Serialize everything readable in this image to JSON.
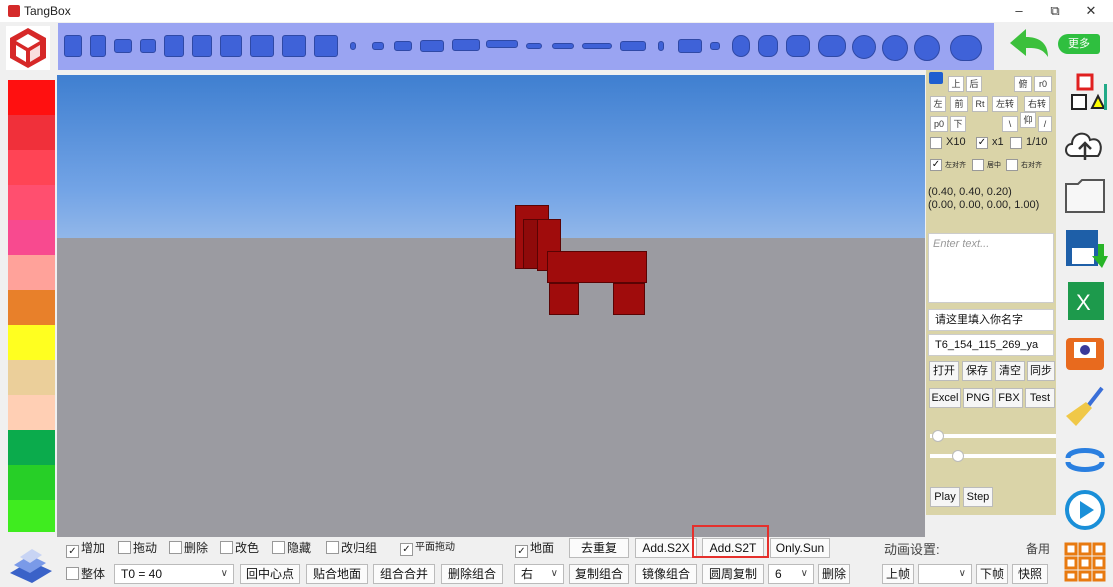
{
  "window": {
    "title": "TangBox",
    "min": "–",
    "restore": "⧉",
    "close": "✕"
  },
  "toolbar": {
    "more_label": "更多"
  },
  "palette": {
    "colors": [
      "#ff1010",
      "#f0303a",
      "#ff4455",
      "#ff4f6f",
      "#f84a8f",
      "#ffa29a",
      "#e8802a",
      "#ffff20",
      "#ebcf9a",
      "#ffcfb4",
      "#0bab4c",
      "#27cf27",
      "#3fec1f"
    ]
  },
  "panel": {
    "row1": [
      "上",
      "后",
      "俯",
      "r0"
    ],
    "row2": [
      "左",
      "前",
      "Rt",
      "左转",
      "右转"
    ],
    "row3": [
      "p0",
      "下",
      "\\",
      "仰",
      "/"
    ],
    "scale": [
      "X10",
      "x1",
      "1/10"
    ],
    "align": [
      "左对齐",
      "居中",
      "右对齐"
    ],
    "coords_line1": "(0.40, 0.40, 0.20)",
    "coords_line2": "(0.00, 0.00, 0.00, 1.00)",
    "notes_placeholder": "Enter text...",
    "name_field": "请这里填入你名字",
    "file_field": "T6_154_115_269_ya",
    "file_buttons": [
      "打开",
      "保存",
      "清空",
      "同步"
    ],
    "export_buttons": [
      "Excel",
      "PNG",
      "FBX",
      "Test"
    ],
    "play": "Play",
    "step": "Step"
  },
  "bottom": {
    "row1_checks": [
      "增加",
      "拖动",
      "删除",
      "改色",
      "隐藏",
      "改归组",
      "平面拖动"
    ],
    "ground_check": "地面",
    "dedupe": "去重复",
    "add_s2x": "Add.S2X",
    "add_s2t": "Add.S2T",
    "only_sun": "Only.Sun",
    "anim_label": "动画设置:",
    "backup": "备用",
    "whole": "整体",
    "t0_select": "T0 = 40",
    "row2_buttons": [
      "回中心点",
      "贴合地面",
      "组合合并",
      "删除组合"
    ],
    "dir_select": "右",
    "copy_group": "复制组合",
    "mirror_group": "镜像组合",
    "circle_copy": "圆周复制",
    "count_select": "6",
    "delete": "删除",
    "prev_frame": "上帧",
    "next_frame": "下帧",
    "snapshot": "快照"
  }
}
